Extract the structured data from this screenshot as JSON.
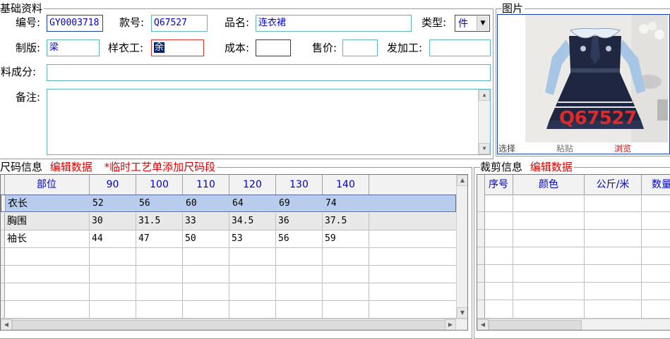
{
  "basic": {
    "legend": "基础资料",
    "labels": {
      "code": "编号:",
      "style_no": "款号:",
      "product_name": "品名:",
      "type": "类型:",
      "pattern_maker": "制版:",
      "sample_worker": "样衣工:",
      "cost": "成本:",
      "price": "售价:",
      "processor": "发加工:",
      "fabric": "面料成分:",
      "remark": "备注:"
    },
    "values": {
      "code": "GY0003718",
      "style_no": "Q67527",
      "product_name": "连衣裙",
      "type": "件",
      "pattern_maker": "梁",
      "sample_worker": "余",
      "cost": "",
      "price": "",
      "processor": "",
      "fabric": "",
      "remark": ""
    }
  },
  "photo": {
    "legend": "图片",
    "overlay_code": "Q67527",
    "buttons": {
      "select": "选择",
      "paste": "粘贴",
      "browse": "浏览"
    }
  },
  "size": {
    "legend": "尺码信息",
    "edit_link": "编辑数据",
    "temp_link": "*临时工艺单添加尺码段",
    "columns": [
      "部位",
      "90",
      "100",
      "110",
      "120",
      "130",
      "140"
    ],
    "rows": [
      [
        "衣长",
        "52",
        "56",
        "60",
        "64",
        "69",
        "74"
      ],
      [
        "胸围",
        "30",
        "31.5",
        "33",
        "34.5",
        "36",
        "37.5"
      ],
      [
        "袖长",
        "44",
        "47",
        "50",
        "53",
        "56",
        "59"
      ]
    ]
  },
  "cut": {
    "legend": "裁剪信息",
    "edit_link": "编辑数据",
    "columns": [
      "序号",
      "颜色",
      "公斤/米",
      "数量"
    ]
  },
  "colors": {
    "link_red": "#e00000",
    "header_blue": "#0000c8",
    "selected_row": "#b8cdee"
  }
}
